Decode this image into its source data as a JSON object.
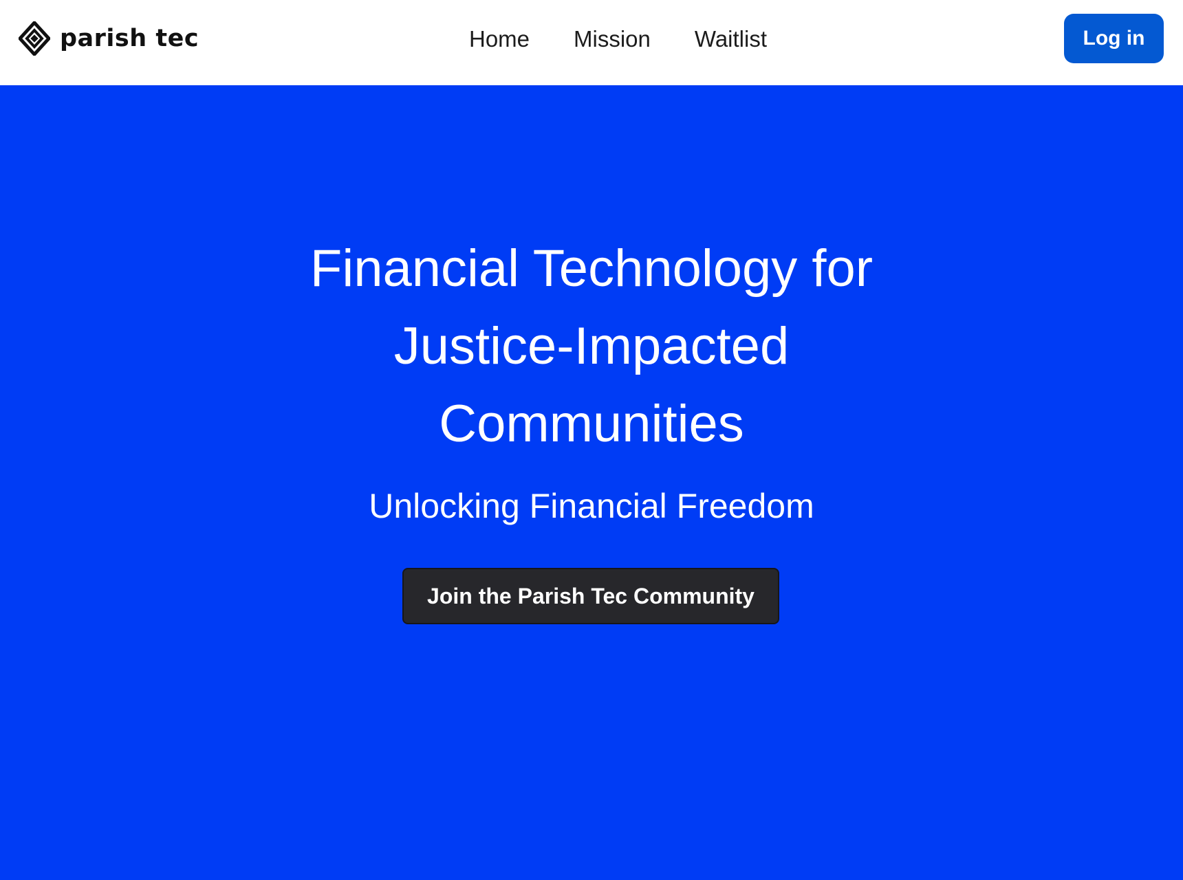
{
  "header": {
    "brand": {
      "name": "parish tec",
      "icon": "diamond-logo-icon"
    },
    "nav": [
      {
        "label": "Home"
      },
      {
        "label": "Mission"
      },
      {
        "label": "Waitlist"
      }
    ],
    "login_label": "Log in"
  },
  "hero": {
    "title": "Financial Technology for Justice-Impacted Communities",
    "subtitle": "Unlocking Financial Freedom",
    "cta_label": "Join the Parish Tec Community"
  },
  "colors": {
    "hero_background": "#003cf5",
    "login_button": "#0459d2",
    "cta_button": "#27272b",
    "header_background": "#ffffff"
  }
}
